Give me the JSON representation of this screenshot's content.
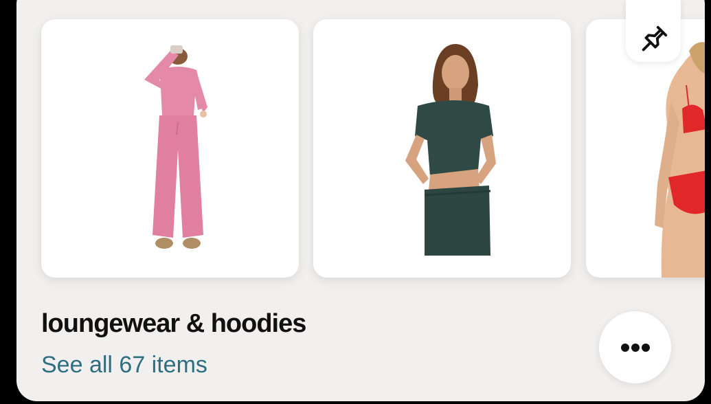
{
  "board": {
    "title": "loungewear & hoodies",
    "items_link": "See all 67 items"
  },
  "icons": {
    "pin": "pin-icon",
    "more": "ellipsis-icon"
  },
  "products": [
    {
      "description": "pink ribbed top and wide-leg pants set",
      "color": "#e48aa8"
    },
    {
      "description": "dark green crop tee and jogger set",
      "color": "#2f4a44"
    },
    {
      "description": "red bikini (partially visible)",
      "color": "#e0282a"
    }
  ],
  "colors": {
    "panel": "#f1f0ee",
    "link": "#2d6e80",
    "title": "#111111"
  }
}
